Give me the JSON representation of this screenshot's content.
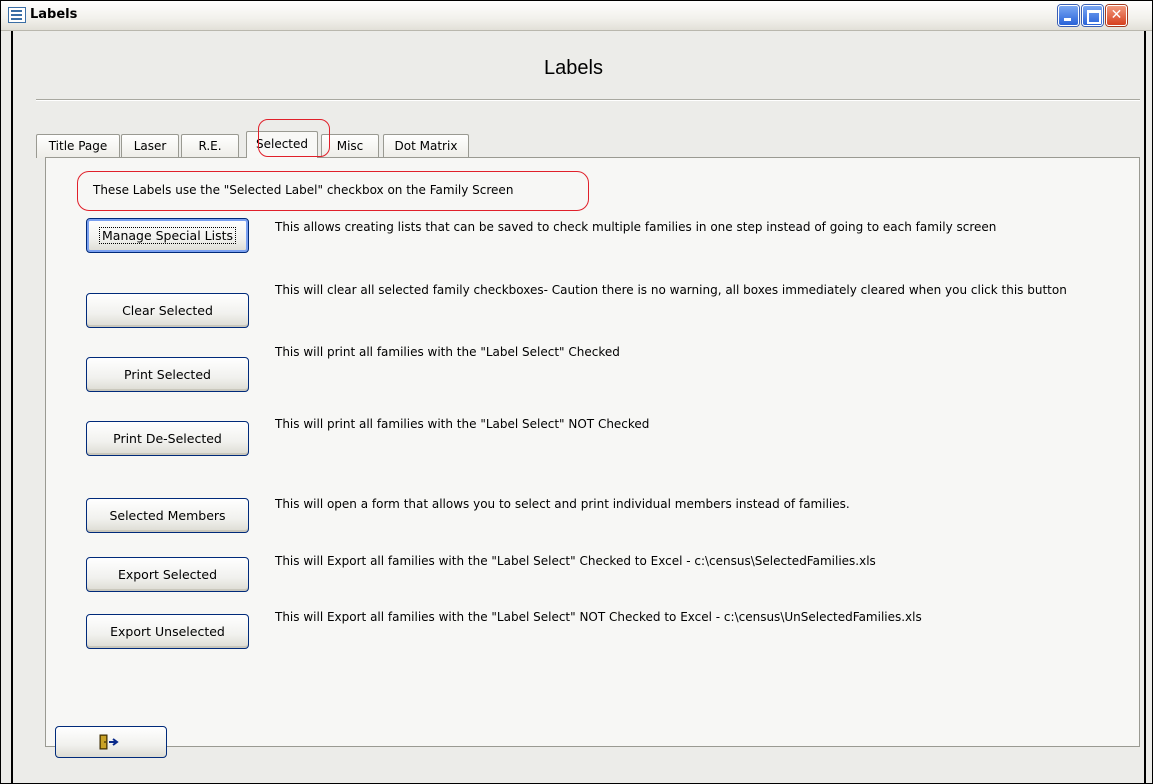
{
  "window": {
    "title": "Labels"
  },
  "form": {
    "heading": "Labels"
  },
  "tabs": [
    {
      "label": "Title Page",
      "active": false
    },
    {
      "label": "Laser",
      "active": false
    },
    {
      "label": "R.E.",
      "active": false
    },
    {
      "label": "Selected",
      "active": true
    },
    {
      "label": "Misc",
      "active": false
    },
    {
      "label": "Dot Matrix",
      "active": false
    }
  ],
  "note": "These Labels use the \"Selected Label\" checkbox on the Family Screen",
  "actions": [
    {
      "label": "Manage Special Lists",
      "description": "This allows creating lists that can be saved to check multiple families in one step instead of going to each family screen"
    },
    {
      "label": "Clear Selected",
      "description": "This will clear all selected family checkboxes- Caution there is no warning, all boxes immediately cleared when you click this button"
    },
    {
      "label": "Print Selected",
      "description": "This will print all families with the \"Label Select\" Checked"
    },
    {
      "label": "Print De-Selected",
      "description": "This will print all families with the \"Label Select\" NOT Checked"
    },
    {
      "label": "Selected Members",
      "description": "This will open a form that allows you to select and print individual members instead of families."
    },
    {
      "label": "Export Selected",
      "description": "This will Export all families with the \"Label Select\" Checked to Excel - c:\\census\\SelectedFamilies.xls"
    },
    {
      "label": "Export Unselected",
      "description": "This will Export all families with the \"Label Select\" NOT Checked to Excel - c:\\census\\UnSelectedFamilies.xls"
    }
  ],
  "icons": {
    "window": "form-window-icon",
    "exit": "exit-door-icon"
  },
  "colors": {
    "highlight": "#e0202a",
    "button_border": "#002a7a"
  }
}
